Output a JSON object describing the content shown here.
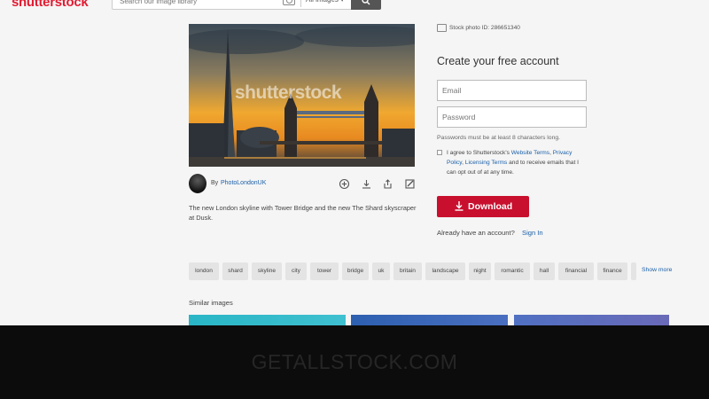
{
  "header": {
    "logo": "shutterstock",
    "search_placeholder": "Search our image library",
    "type_select": "All images ▾"
  },
  "image": {
    "watermark": "shutterstock",
    "author_prefix": "By",
    "author": "PhotoLondonUK",
    "description": "The new London skyline with Tower Bridge and the new The Shard skyscraper at Dusk."
  },
  "signup": {
    "stock_id": "Stock photo ID: 286651340",
    "title": "Create your free account",
    "email_placeholder": "Email",
    "password_placeholder": "Password",
    "password_hint": "Passwords must be at least 8 characters long.",
    "agree_prefix": "I agree to Shutterstock's ",
    "website_terms": "Website Terms",
    "comma": ", ",
    "privacy_policy": "Privacy Policy",
    "comma2": ", ",
    "licensing_terms": "Licensing Terms",
    "agree_suffix": " and to receive emails that I can opt out of at any time.",
    "download_label": "Download",
    "have_account": "Already have an account?",
    "sign_in": "Sign In"
  },
  "keywords": {
    "items": [
      "london",
      "shard",
      "skyline",
      "city",
      "tower",
      "bridge",
      "uk",
      "britain",
      "landscape",
      "night",
      "romantic",
      "hall",
      "financial",
      "finance"
    ],
    "show_more": "Show more"
  },
  "similar": {
    "label": "Similar images"
  },
  "overlay": {
    "text": "GETALLSTOCK.COM"
  },
  "colors": {
    "brand": "#e21b32",
    "download": "#c8102e",
    "link": "#1a5fa8"
  }
}
